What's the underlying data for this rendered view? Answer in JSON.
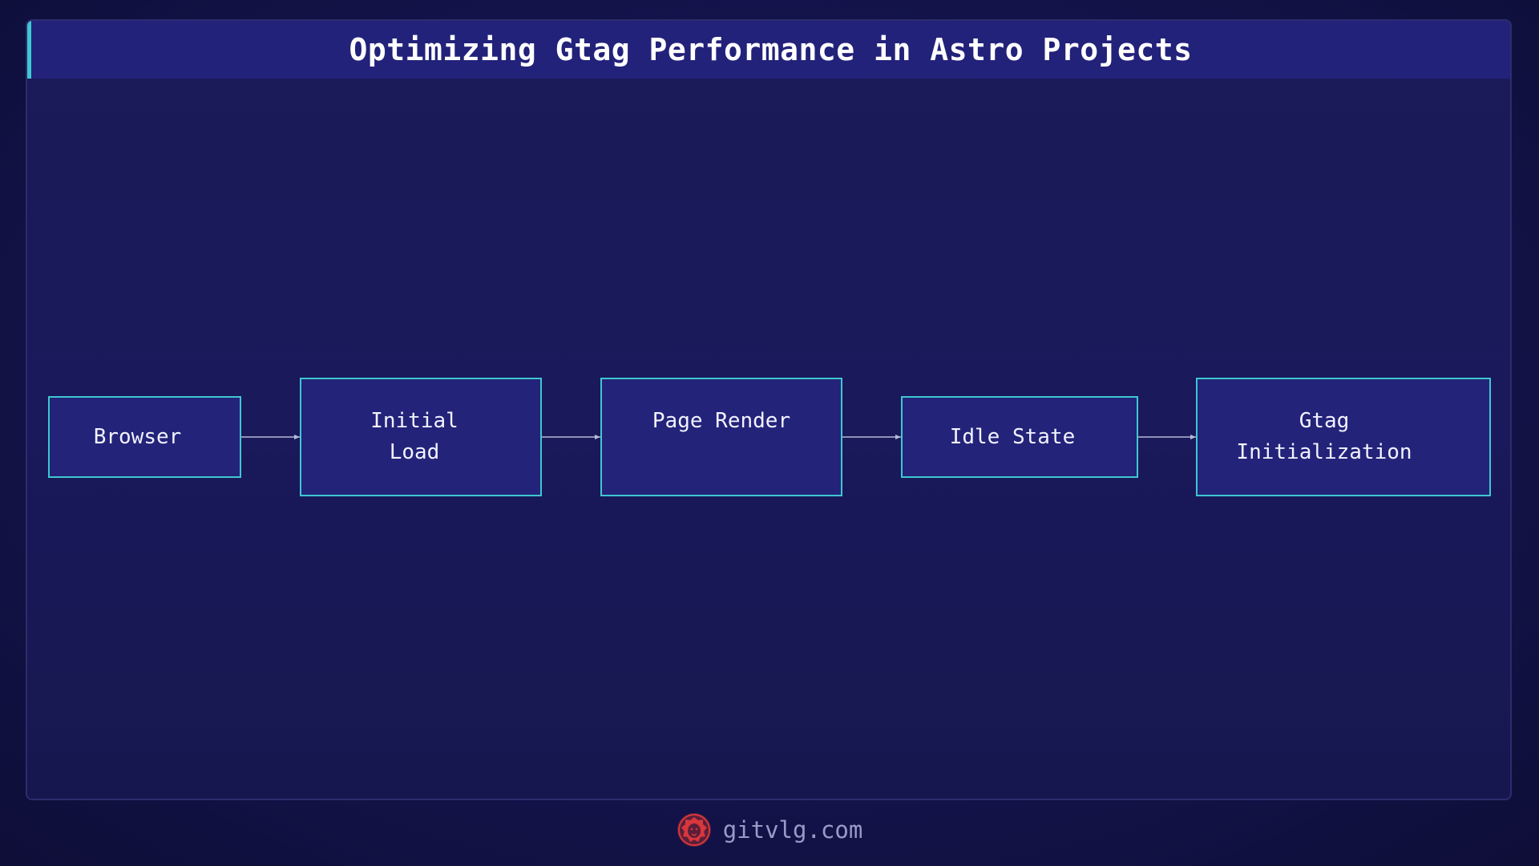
{
  "title": "Optimizing Gtag Performance in Astro Projects",
  "nodes": [
    {
      "id": "browser",
      "label": "Browser"
    },
    {
      "id": "initial-load",
      "label": "Initial\n Load"
    },
    {
      "id": "page-render",
      "label": "Page Render"
    },
    {
      "id": "idle-state",
      "label": "Idle State"
    },
    {
      "id": "gtag-init",
      "label": "Gtag\n Initialization"
    }
  ],
  "edges": [
    {
      "from": "browser",
      "to": "initial-load"
    },
    {
      "from": "initial-load",
      "to": "page-render"
    },
    {
      "from": "page-render",
      "to": "idle-state"
    },
    {
      "from": "idle-state",
      "to": "gtag-init"
    }
  ],
  "footer": {
    "logo": "lion-logo-icon",
    "site": "gitvlg.com"
  },
  "colors": {
    "accent": "#3fc7cf",
    "node_fill": "#23237a",
    "title_bar": "#22227a",
    "arrow": "#b8b8d8",
    "logo_red": "#d8373c"
  }
}
